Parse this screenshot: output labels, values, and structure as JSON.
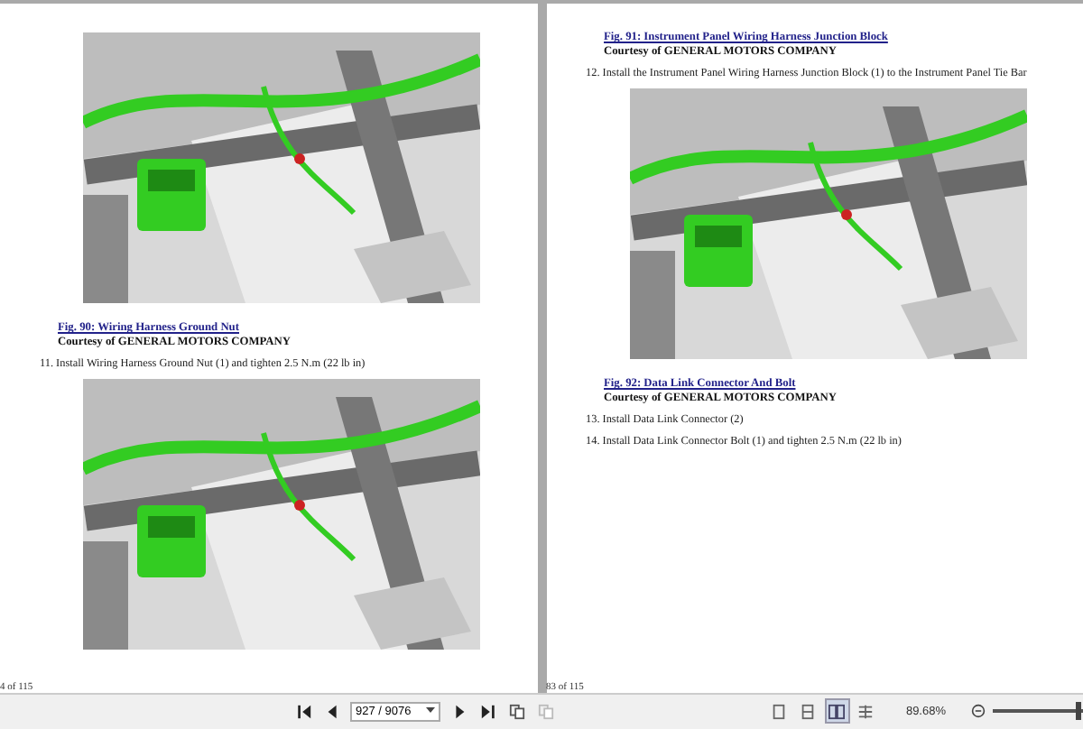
{
  "pages": [
    {
      "blocks": [
        {
          "kind": "picture"
        },
        {
          "kind": "caption",
          "text": "Fig. 90: Wiring Harness Ground Nut"
        },
        {
          "kind": "credit",
          "text": "Courtesy of GENERAL MOTORS COMPANY"
        },
        {
          "kind": "step",
          "text": "11. Install Wiring Harness Ground Nut (1) and tighten 2.5 N.m (22 lb in)"
        },
        {
          "kind": "picture"
        }
      ],
      "footer": "4 of 115"
    },
    {
      "blocks": [
        {
          "kind": "caption",
          "text": "Fig. 91: Instrument Panel Wiring Harness Junction Block"
        },
        {
          "kind": "credit",
          "text": "Courtesy of GENERAL MOTORS COMPANY"
        },
        {
          "kind": "step",
          "text": "12. Install the Instrument Panel Wiring Harness Junction Block (1) to the Instrument Panel Tie Bar"
        },
        {
          "kind": "picture"
        },
        {
          "kind": "caption",
          "text": "Fig. 92: Data Link Connector And Bolt"
        },
        {
          "kind": "credit",
          "text": "Courtesy of GENERAL MOTORS COMPANY"
        },
        {
          "kind": "step",
          "text": "13. Install Data Link Connector (2)"
        },
        {
          "kind": "step",
          "text": "14. Install Data Link Connector Bolt (1) and tighten 2.5 N.m (22 lb in)"
        }
      ],
      "footer": "83 of 115"
    }
  ],
  "toolbar": {
    "page_field": "927 / 9076",
    "view_modes": [
      {
        "selected": false
      },
      {
        "selected": false
      },
      {
        "selected": true
      },
      {
        "selected": false
      }
    ],
    "zoom": "89.68%",
    "zoom_slider": {
      "level": 0.92
    }
  }
}
